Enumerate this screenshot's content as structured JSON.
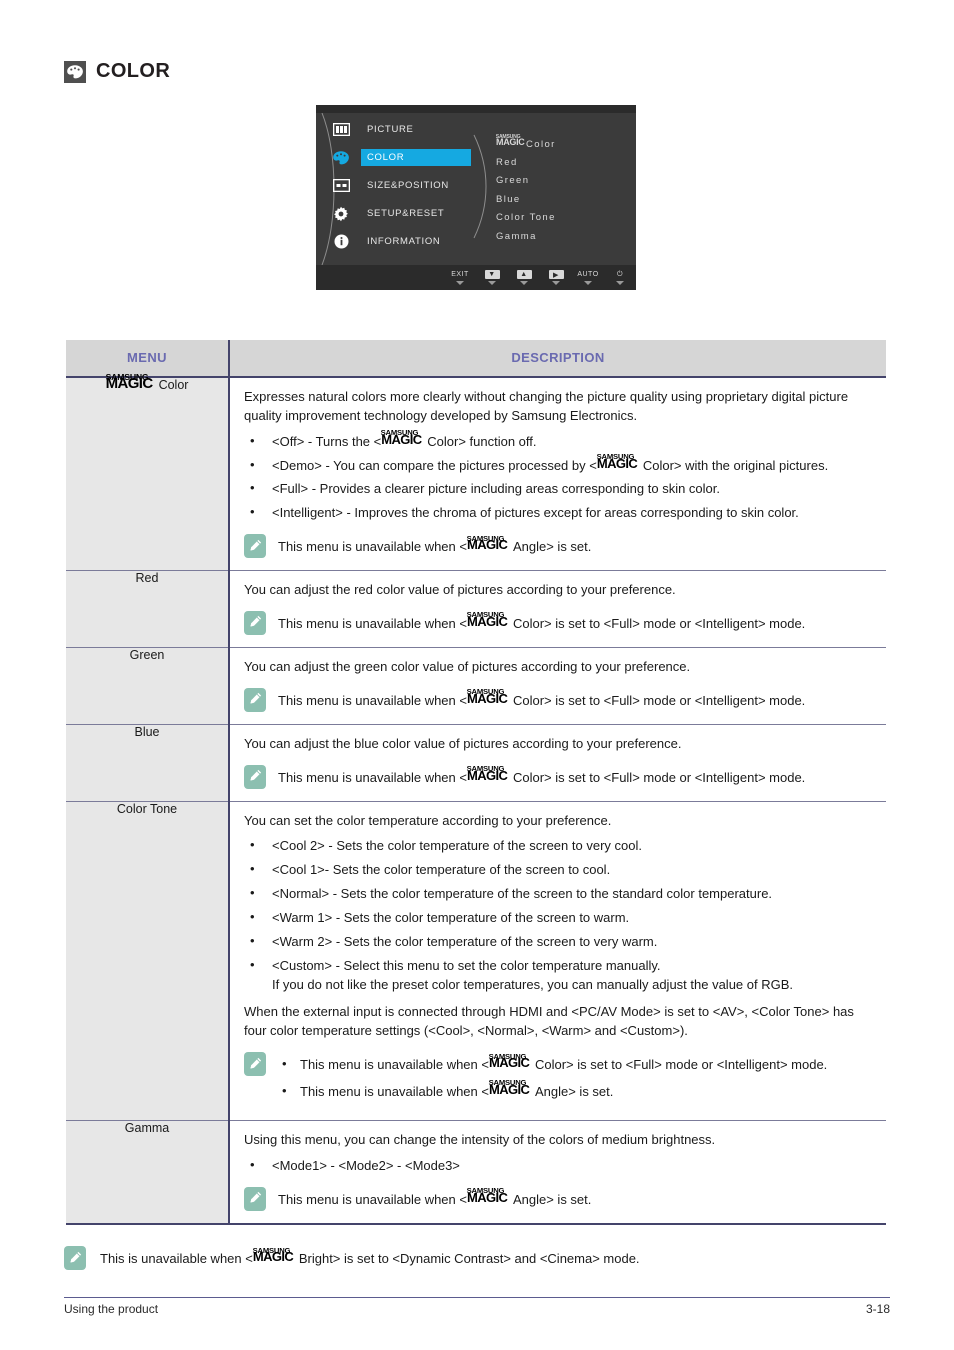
{
  "heading": {
    "icon": "palette-icon",
    "title": "COLOR"
  },
  "osd": {
    "left_menu": [
      {
        "label": "PICTURE",
        "icon": "picture-icon",
        "active": false
      },
      {
        "label": "COLOR",
        "icon": "palette-icon",
        "active": true
      },
      {
        "label": "SIZE&POSITION",
        "icon": "size-position-icon",
        "active": false
      },
      {
        "label": "SETUP&RESET",
        "icon": "gear-icon",
        "active": false
      },
      {
        "label": "INFORMATION",
        "icon": "info-icon",
        "active": false
      }
    ],
    "submenu": [
      {
        "logo": true,
        "label": "Color"
      },
      {
        "logo": false,
        "label": "Red"
      },
      {
        "logo": false,
        "label": "Green"
      },
      {
        "logo": false,
        "label": "Blue"
      },
      {
        "logo": false,
        "label": "Color Tone"
      },
      {
        "logo": false,
        "label": "Gamma"
      }
    ],
    "bottom_buttons": [
      {
        "label": "EXIT",
        "glyph": "text"
      },
      {
        "label": "▼",
        "glyph": "keycap-down"
      },
      {
        "label": "▲",
        "glyph": "keycap-up"
      },
      {
        "label": "▶",
        "glyph": "keycap-enter"
      },
      {
        "label": "AUTO",
        "glyph": "text"
      },
      {
        "label": "⏻",
        "glyph": "power"
      }
    ],
    "highlight_color": "#15a9e1"
  },
  "table": {
    "headers": {
      "menu": "MENU",
      "description": "DESCRIPTION"
    },
    "header_text_color": "#6a6ab0",
    "rows": [
      {
        "menu_logo": true,
        "menu_label": "Color",
        "paragraphs": [
          "Expresses natural colors more clearly without changing the picture quality using proprietary digital picture quality improvement technology developed by Samsung Electronics."
        ],
        "bullets": [
          {
            "pre": "<Off> - Turns the <",
            "logo": true,
            "post": "Color> function off."
          },
          {
            "pre": "<Demo> - You can compare the pictures processed by <",
            "logo": true,
            "post": "Color> with the original pictures."
          },
          {
            "pre": "<Full> - Provides a clearer picture including areas corresponding to skin color.",
            "logo": false,
            "post": ""
          },
          {
            "pre": "<Intelligent> - Improves the chroma of pictures except for areas corresponding to skin color.",
            "logo": false,
            "post": ""
          }
        ],
        "note": {
          "pre": "This menu is unavailable when <",
          "logo": true,
          "post": "Angle> is set."
        }
      },
      {
        "menu_logo": false,
        "menu_label": "Red",
        "paragraphs": [
          "You can adjust the red color value of pictures according to your preference."
        ],
        "bullets": [],
        "note": {
          "pre": "This menu is unavailable when <",
          "logo": true,
          "post": "Color> is set to <Full> mode or <Intelligent> mode."
        }
      },
      {
        "menu_logo": false,
        "menu_label": "Green",
        "paragraphs": [
          "You can adjust the green color value of pictures according to your preference."
        ],
        "bullets": [],
        "note": {
          "pre": "This menu is unavailable when <",
          "logo": true,
          "post": "Color> is set to <Full> mode or <Intelligent> mode."
        }
      },
      {
        "menu_logo": false,
        "menu_label": "Blue",
        "paragraphs": [
          "You can adjust the blue color value of pictures according to your preference."
        ],
        "bullets": [],
        "note": {
          "pre": "This menu is unavailable when <",
          "logo": true,
          "post": "Color> is set to <Full> mode or <Intelligent> mode."
        }
      },
      {
        "menu_logo": false,
        "menu_label": "Color Tone",
        "paragraphs": [
          "You can set the color temperature according to your preference."
        ],
        "bullets": [
          {
            "pre": "<Cool 2> - Sets the color temperature of the screen to very cool.",
            "logo": false,
            "post": ""
          },
          {
            "pre": "<Cool 1>- Sets the color temperature of the screen to cool.",
            "logo": false,
            "post": ""
          },
          {
            "pre": "<Normal> - Sets the color temperature of the screen to the standard color temperature.",
            "logo": false,
            "post": ""
          },
          {
            "pre": "<Warm 1> - Sets the color temperature of the screen to warm.",
            "logo": false,
            "post": ""
          },
          {
            "pre": "<Warm 2> - Sets the color temperature of the screen to very warm.",
            "logo": false,
            "post": ""
          },
          {
            "pre": "<Custom> - Select this menu to set the color temperature manually.",
            "logo": false,
            "post": "",
            "extra": "If you do not like the preset color temperatures, you can manually adjust the value of RGB."
          }
        ],
        "trailing_paragraph": "When the external input is connected through HDMI and <PC/AV Mode> is set to <AV>, <Color Tone> has four color temperature settings (<Cool>, <Normal>, <Warm> and <Custom>).",
        "note_list": [
          {
            "pre": "This menu is unavailable when <",
            "logo": true,
            "post": "Color> is set to <Full> mode or <Intelligent> mode."
          },
          {
            "pre": "This menu is unavailable when <",
            "logo": true,
            "post": "Angle> is set."
          }
        ]
      },
      {
        "menu_logo": false,
        "menu_label": "Gamma",
        "paragraphs": [
          "Using this menu, you can change the intensity of the colors of medium brightness."
        ],
        "bullets": [
          {
            "pre": "<Mode1> - <Mode2> - <Mode3>",
            "logo": false,
            "post": ""
          }
        ],
        "note": {
          "pre": "This menu is unavailable when <",
          "logo": true,
          "post": "Angle> is set."
        }
      }
    ]
  },
  "page_note": {
    "pre": "This is unavailable when <",
    "logo": true,
    "post": "Bright> is set to <Dynamic Contrast> and <Cinema> mode."
  },
  "logo": {
    "line1": "SAMSUNG",
    "line2": "MAGIC"
  },
  "footer": {
    "left": "Using the product",
    "right": "3-18"
  }
}
